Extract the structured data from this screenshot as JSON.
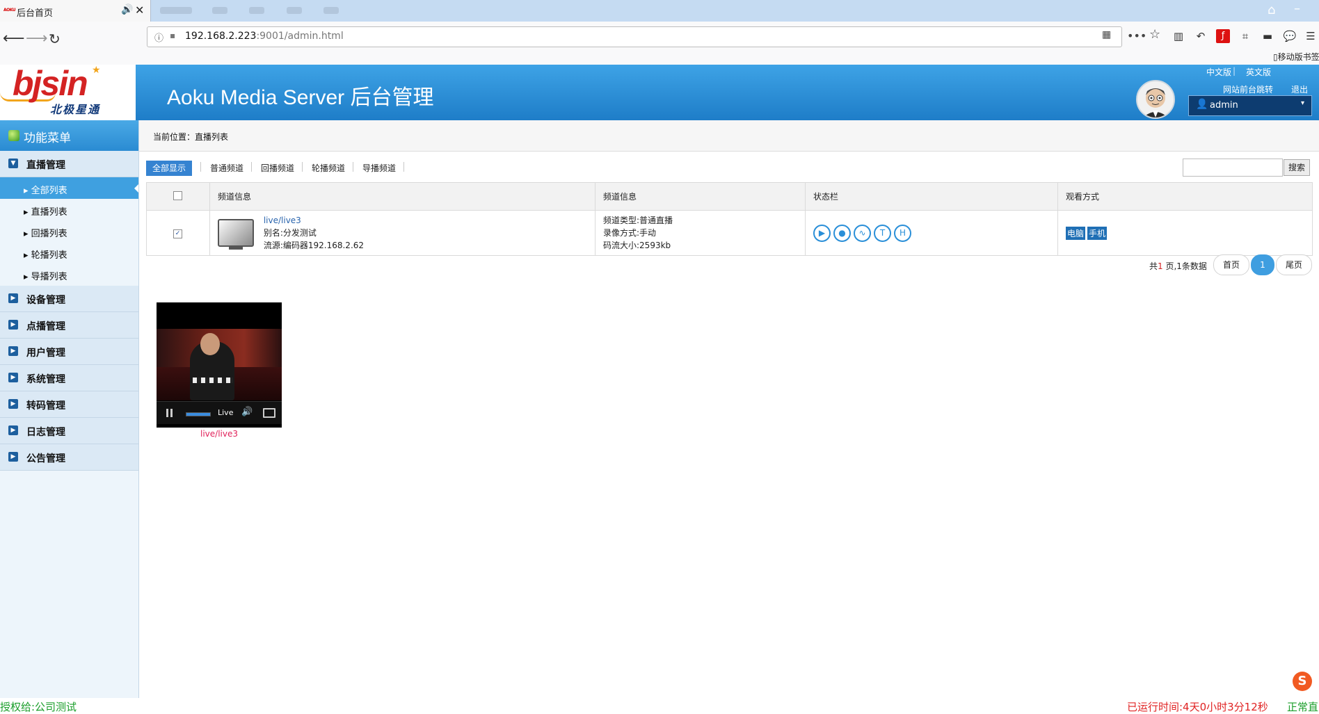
{
  "browser": {
    "tab_title": "后台首页",
    "tab_favicon_text": "AOKU",
    "url_host": "192.168.2.223",
    "url_rest": ":9001/admin.html",
    "mobile_bookmarks": "移动版书签"
  },
  "header": {
    "logo_text": "bjsin",
    "logo_subtitle": "北极星通",
    "title": "Aoku Media Server 后台管理",
    "lang_cn": "中文版",
    "lang_sep": "|",
    "lang_en": "英文版",
    "frontend_link": "网站前台跳转",
    "logout_link": "退出",
    "username": "admin"
  },
  "sidebar": {
    "title": "功能菜单",
    "groups": [
      {
        "label": "直播管理",
        "expanded": true
      },
      {
        "label": "设备管理"
      },
      {
        "label": "点播管理"
      },
      {
        "label": "用户管理"
      },
      {
        "label": "系统管理"
      },
      {
        "label": "转码管理"
      },
      {
        "label": "日志管理"
      },
      {
        "label": "公告管理"
      }
    ],
    "live_items": [
      {
        "label": "全部列表",
        "active": true
      },
      {
        "label": "直播列表"
      },
      {
        "label": "回播列表"
      },
      {
        "label": "轮播列表"
      },
      {
        "label": "导播列表"
      }
    ]
  },
  "main": {
    "breadcrumb": "当前位置：直播列表",
    "filters": [
      "全部显示",
      "普通频道",
      "回播频道",
      "轮播频道",
      "导播频道"
    ],
    "active_filter": 0,
    "search_button": "搜索",
    "table": {
      "headers": [
        "频道信息",
        "频道信息",
        "状态栏",
        "观看方式"
      ],
      "rows": [
        {
          "checked": true,
          "channel_link": "live/live3",
          "alias": "别名:分发测试",
          "source": "流源:编码器192.168.2.62",
          "type": "频道类型:普通直播",
          "record": "录像方式:手动",
          "bitrate": "码流大小:2593kb",
          "status_icons": [
            "play-icon",
            "camera-icon",
            "wave-icon",
            "T",
            "H"
          ],
          "watch": [
            "电脑",
            "手机"
          ]
        }
      ]
    },
    "pagination": {
      "prefix": "共",
      "total_pages": "1",
      "suffix": " 页,1条数据",
      "first": "首页",
      "current": "1",
      "last": "尾页"
    },
    "player": {
      "live_label": "Live",
      "caption": "live/live3",
      "progress": 1.0
    }
  },
  "footer": {
    "license": "授权给:公司测试",
    "uptime": "已运行时间:4天0小时3分12秒",
    "status": "正常直"
  },
  "colors": {
    "header_blue": "#1e7dc8",
    "sidebar_active": "#3fa0e0",
    "accent_blue": "#2a8fd8",
    "footer_green": "#1a9e2a",
    "footer_red": "#e02222"
  }
}
